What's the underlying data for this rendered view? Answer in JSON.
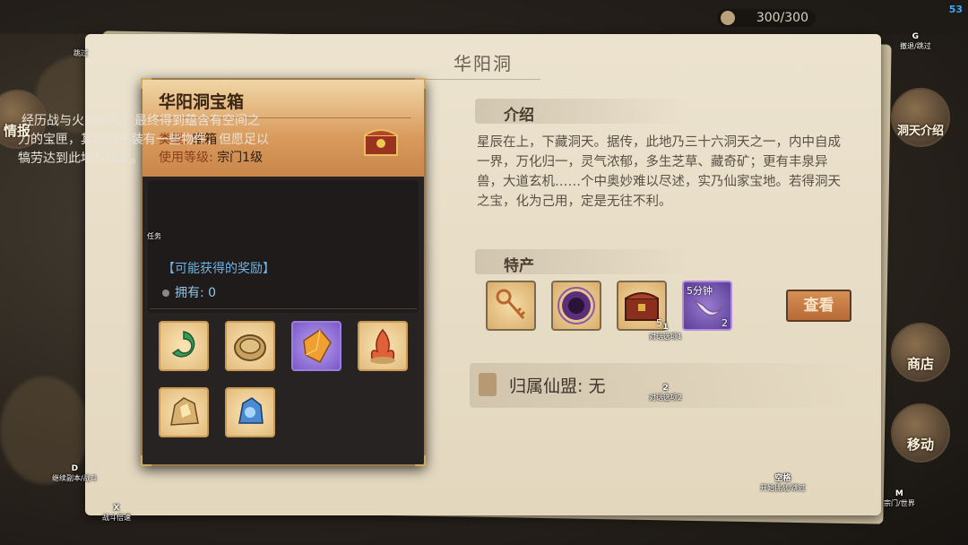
{
  "fps": "53",
  "stamina": "300/300",
  "panel": {
    "title": "华阳洞"
  },
  "intro": {
    "heading": "介绍",
    "text": "星辰在上，下藏洞天。据传，此地乃三十六洞天之一，内中自成一界，万化归一，灵气浓郁，多生芝草、藏奇矿；更有丰泉异兽，大道玄机……个中奥妙难以尽述，实乃仙家宝地。若得洞天之宝，化为己用，定是无往不利。"
  },
  "specialty": {
    "heading": "特产",
    "items": [
      {
        "icon": "key-icon",
        "count": ""
      },
      {
        "icon": "purple-orb-icon",
        "count": ""
      },
      {
        "icon": "treasure-chest-icon",
        "count": "5"
      },
      {
        "icon": "claw-icon",
        "count": "2",
        "tag": "5分钟"
      }
    ],
    "view_button": "查看"
  },
  "guild": {
    "label": "归属仙盟:",
    "value": "无"
  },
  "item_card": {
    "name": "华阳洞宝箱",
    "type_label": "类型:",
    "type_value": "宝箱",
    "level_label": "使用等级:",
    "level_value": "宗门1级",
    "description": "经历战与火的洗礼，最终得到蕴含有空间之力的宝匣，其内似乎装有一些物件，但愿足以犒劳达到此地的仙友。",
    "reward_heading": "【可能获得的奖励】",
    "owned_label": "拥有:",
    "owned_value": "0",
    "rewards": [
      {
        "icon": "jade-ring-icon",
        "quality": "gold"
      },
      {
        "icon": "coin-icon",
        "quality": "gold"
      },
      {
        "icon": "amber-crystal-icon",
        "quality": "purple"
      },
      {
        "icon": "flame-herb-icon",
        "quality": "gold"
      },
      {
        "icon": "gold-ore-icon",
        "quality": "gold"
      },
      {
        "icon": "blue-ore-icon",
        "quality": "gold"
      }
    ]
  },
  "side_buttons": {
    "left_top": "情报",
    "right_top": "洞天介绍",
    "right_mid": "商店",
    "right_low": "移动"
  },
  "key_hints": {
    "skip": {
      "key": "",
      "label": "跳过"
    },
    "g": {
      "key": "G",
      "label": "撤退/跳过"
    },
    "task": {
      "key": "",
      "label": "任务"
    },
    "opt1": {
      "key": "1",
      "label": "对话选项1"
    },
    "opt2": {
      "key": "2",
      "label": "对话选项2"
    },
    "d": {
      "key": "D",
      "label": "继续副本/战斗"
    },
    "x": {
      "key": "X",
      "label": "战斗倍速"
    },
    "space": {
      "key": "空格",
      "label": "开始挑战/跳过"
    },
    "m": {
      "key": "M",
      "label": "宗门/世界"
    }
  },
  "colors": {
    "accent": "#c9864a",
    "reward_text": "#6fb3e6",
    "card_bg": "#262322"
  }
}
